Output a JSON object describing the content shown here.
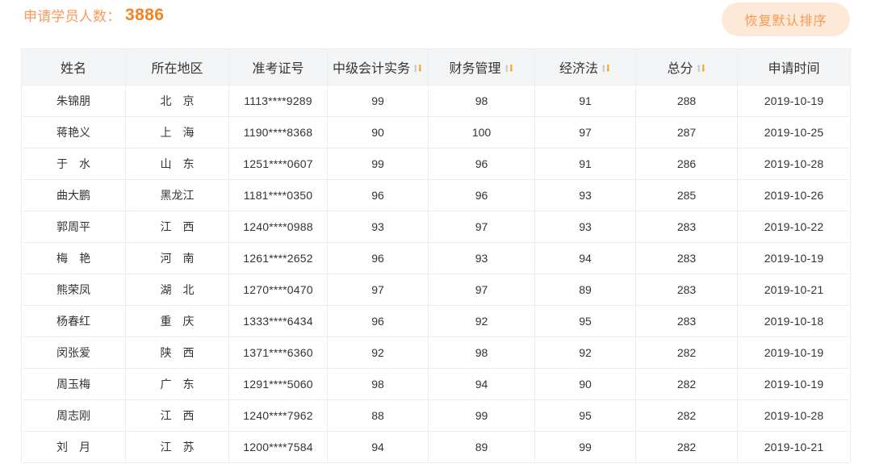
{
  "header": {
    "count_label": "申请学员人数：",
    "count_value": "3886",
    "reset_button_label": "恢复默认排序",
    "label_color": "#f89a5c",
    "value_color": "#f58220",
    "button_bg": "#fde9d7",
    "button_text_color": "#f79a54"
  },
  "table": {
    "header_bg": "#f4f5f6",
    "border_color": "#ebedf0",
    "sort_icon_up_color": "#c9c9c9",
    "sort_icon_down_color": "#f5a623",
    "columns": [
      {
        "label": "姓名",
        "sortable": false,
        "icon": ""
      },
      {
        "label": "所在地区",
        "sortable": false,
        "icon": ""
      },
      {
        "label": "准考证号",
        "sortable": false,
        "icon": ""
      },
      {
        "label": "中级会计实务",
        "sortable": true,
        "icon": "sort-updown-icon"
      },
      {
        "label": "财务管理",
        "sortable": true,
        "icon": "sort-updown-icon"
      },
      {
        "label": "经济法",
        "sortable": true,
        "icon": "sort-updown-icon"
      },
      {
        "label": "总分",
        "sortable": true,
        "icon": "sort-updown-icon"
      },
      {
        "label": "申请时间",
        "sortable": false,
        "icon": ""
      }
    ],
    "rows": [
      {
        "name": "朱锦朋",
        "region": "北 京",
        "ticket": "1113****9289",
        "accounting": "99",
        "finance": "98",
        "law": "91",
        "total": "288",
        "date": "2019-10-19"
      },
      {
        "name": "蒋艳义",
        "region": "上 海",
        "ticket": "1190****8368",
        "accounting": "90",
        "finance": "100",
        "law": "97",
        "total": "287",
        "date": "2019-10-25"
      },
      {
        "name": "于 水",
        "region": "山 东",
        "ticket": "1251****0607",
        "accounting": "99",
        "finance": "96",
        "law": "91",
        "total": "286",
        "date": "2019-10-28"
      },
      {
        "name": "曲大鹏",
        "region": "黑龙江",
        "ticket": "1181****0350",
        "accounting": "96",
        "finance": "96",
        "law": "93",
        "total": "285",
        "date": "2019-10-26"
      },
      {
        "name": "郭周平",
        "region": "江 西",
        "ticket": "1240****0988",
        "accounting": "93",
        "finance": "97",
        "law": "93",
        "total": "283",
        "date": "2019-10-22"
      },
      {
        "name": "梅 艳",
        "region": "河 南",
        "ticket": "1261****2652",
        "accounting": "96",
        "finance": "93",
        "law": "94",
        "total": "283",
        "date": "2019-10-19"
      },
      {
        "name": "熊荣凤",
        "region": "湖 北",
        "ticket": "1270****0470",
        "accounting": "97",
        "finance": "97",
        "law": "89",
        "total": "283",
        "date": "2019-10-21"
      },
      {
        "name": "杨春红",
        "region": "重 庆",
        "ticket": "1333****6434",
        "accounting": "96",
        "finance": "92",
        "law": "95",
        "total": "283",
        "date": "2019-10-18"
      },
      {
        "name": "闵张爱",
        "region": "陕 西",
        "ticket": "1371****6360",
        "accounting": "92",
        "finance": "98",
        "law": "92",
        "total": "282",
        "date": "2019-10-19"
      },
      {
        "name": "周玉梅",
        "region": "广 东",
        "ticket": "1291****5060",
        "accounting": "98",
        "finance": "94",
        "law": "90",
        "total": "282",
        "date": "2019-10-19"
      },
      {
        "name": "周志刚",
        "region": "江 西",
        "ticket": "1240****7962",
        "accounting": "88",
        "finance": "99",
        "law": "95",
        "total": "282",
        "date": "2019-10-28"
      },
      {
        "name": "刘 月",
        "region": "江 苏",
        "ticket": "1200****7584",
        "accounting": "94",
        "finance": "89",
        "law": "99",
        "total": "282",
        "date": "2019-10-21"
      }
    ]
  }
}
